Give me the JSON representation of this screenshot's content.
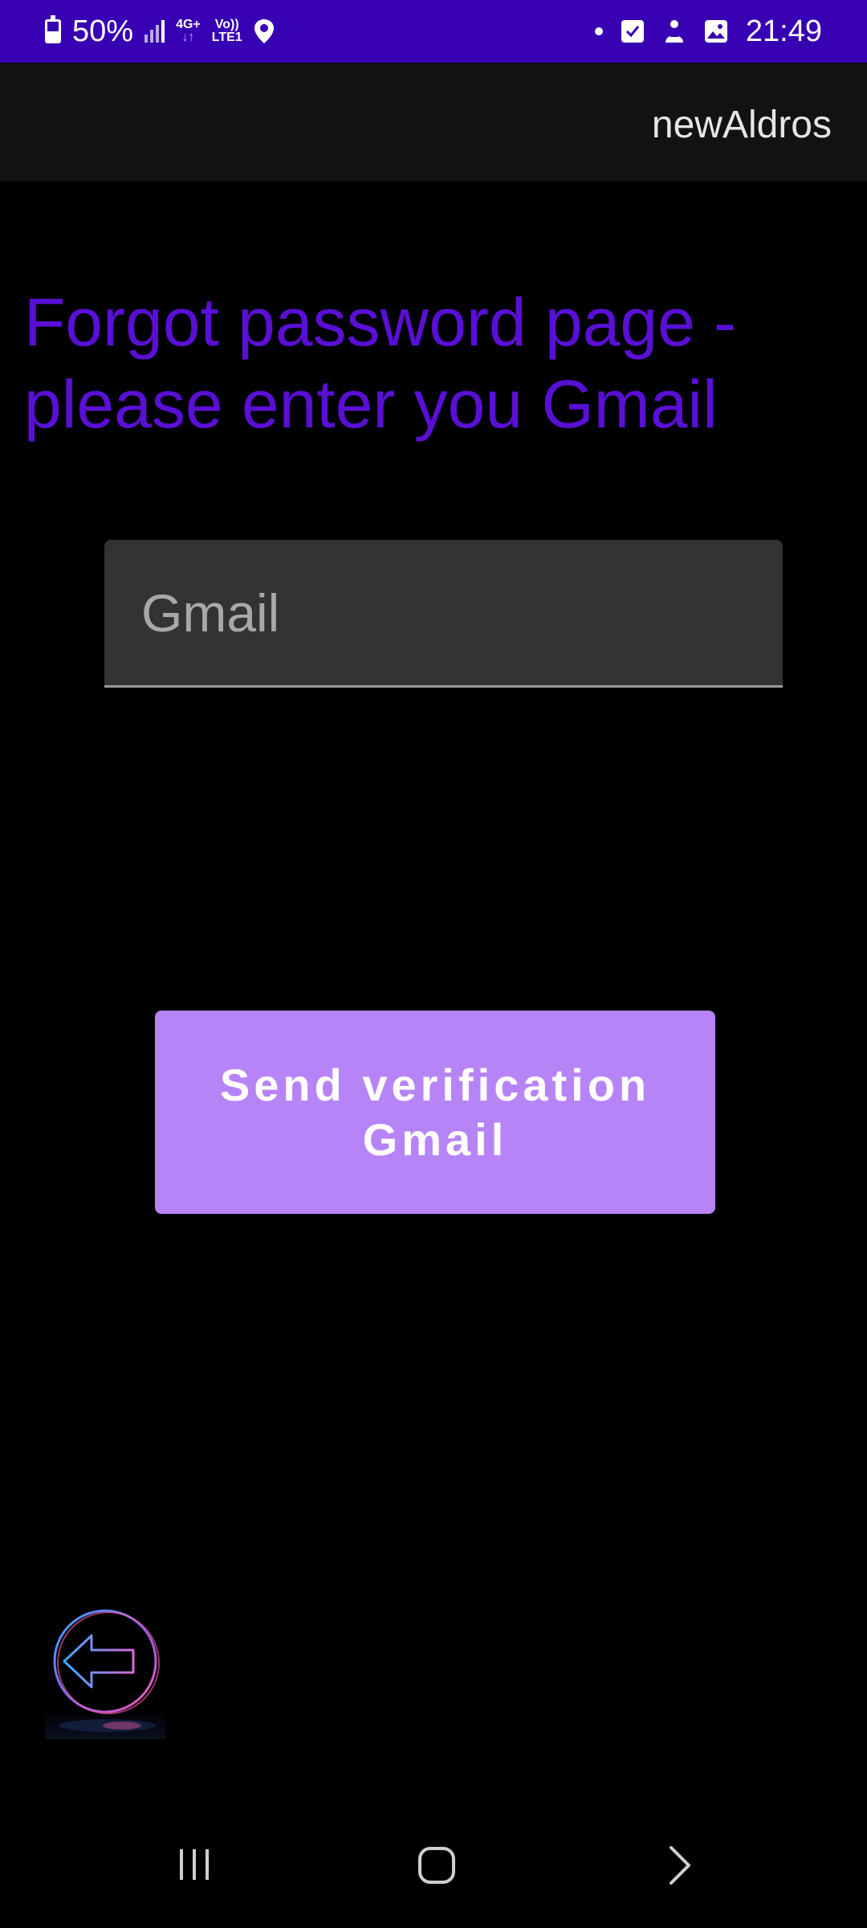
{
  "status_bar": {
    "battery": "50%",
    "network_top": "4G+",
    "network_bottom": "LTE1",
    "volte_top": "Vo))",
    "time": "21:49"
  },
  "app_bar": {
    "title": "newAldros"
  },
  "main": {
    "heading": "Forgot password page - please enter you Gmail",
    "gmail_input": {
      "placeholder": "Gmail",
      "value": ""
    },
    "send_button_label": "Send verification Gmail"
  },
  "icons": {
    "back": "back-arrow-icon",
    "nav_recents": "recents-icon",
    "nav_home": "home-icon",
    "nav_back": "chevron-right-icon"
  },
  "colors": {
    "status_bar": "#3700B3",
    "heading": "#5a0fd6",
    "button": "#b784f7",
    "input_bg": "#333333"
  }
}
